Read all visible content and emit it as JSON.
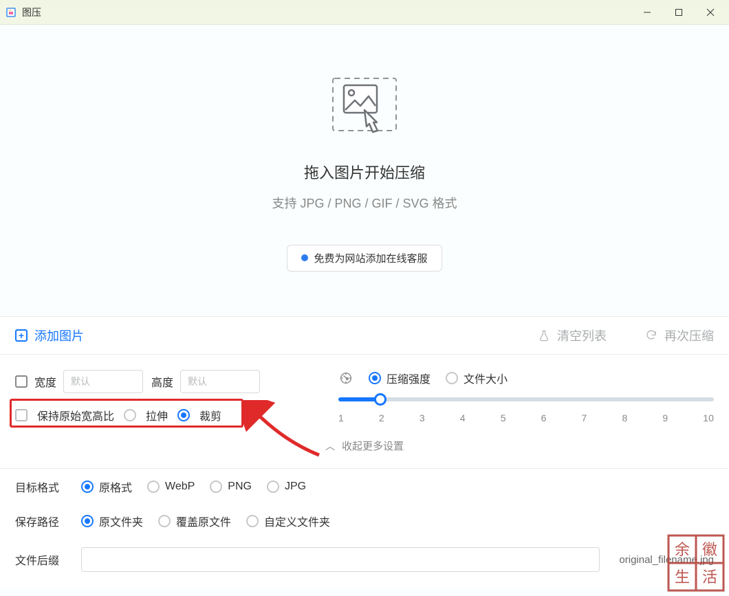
{
  "window": {
    "title": "图压"
  },
  "dropzone": {
    "title": "拖入图片开始压缩",
    "subtitle": "支持 JPG / PNG / GIF / SVG 格式",
    "promo": "免费为网站添加在线客服"
  },
  "toolbar": {
    "add_image": "添加图片",
    "clear_list": "清空列表",
    "recompress": "再次压缩"
  },
  "size": {
    "width_label": "宽度",
    "width_placeholder": "默认",
    "height_label": "高度",
    "height_placeholder": "默认",
    "keep_ratio": "保持原始宽高比",
    "stretch": "拉伸",
    "crop": "裁剪"
  },
  "compress": {
    "mode_quality": "压缩强度",
    "mode_filesize": "文件大小",
    "ticks": [
      "1",
      "2",
      "3",
      "4",
      "5",
      "6",
      "7",
      "8",
      "9",
      "10"
    ],
    "value_index": 1
  },
  "collapse": {
    "label": "收起更多设置"
  },
  "format": {
    "label": "目标格式",
    "options": {
      "original": "原格式",
      "webp": "WebP",
      "png": "PNG",
      "jpg": "JPG"
    }
  },
  "save": {
    "label": "保存路径",
    "options": {
      "original_dir": "原文件夹",
      "overwrite": "覆盖原文件",
      "custom": "自定义文件夹"
    }
  },
  "suffix": {
    "label": "文件后缀",
    "example": "original_filename.jpg"
  }
}
